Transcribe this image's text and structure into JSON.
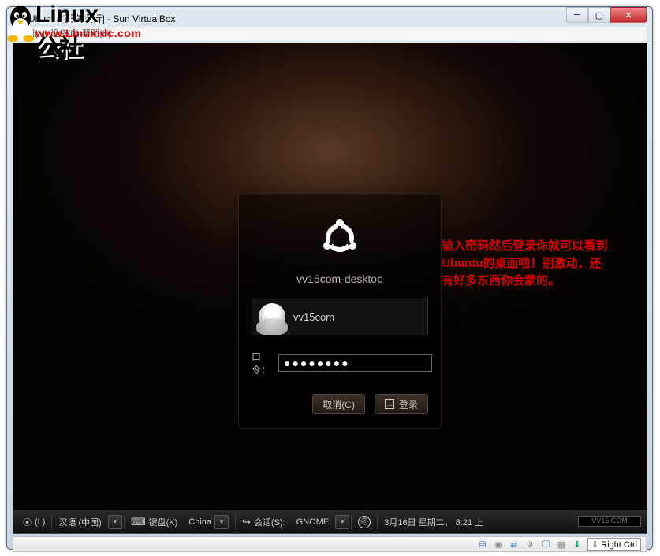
{
  "watermark": {
    "title": "Linux公社",
    "url": "www.Linuxidc.com"
  },
  "window": {
    "title": "Ubuntu [正在运行] - Sun VirtualBox"
  },
  "menubar": {
    "items": [
      "控制(M)",
      "设备(D)",
      "帮助(H)"
    ]
  },
  "annotation": {
    "text": "输入密码然后登录你就可以看到Ubuntu的桌面啦！别激动，还有好多东西你会蒙的。"
  },
  "login": {
    "hostname": "vv15com-desktop",
    "username": "vv15com",
    "password_label": "口令：",
    "password_value": "●●●●●●●●",
    "cancel_label": "取消(C)",
    "login_label": "登录"
  },
  "gdm": {
    "lang_key": "(L)",
    "lang_value": "汉语 (中国)",
    "kbd_label": "键盘(K)",
    "kbd_value": "China",
    "session_label": "会话(S):",
    "session_value": "GNOME",
    "clock": "3月16日 星期二， 8:21 上"
  },
  "statusbar": {
    "hostkey": "Right Ctrl"
  },
  "vv15": "VV15.COM"
}
